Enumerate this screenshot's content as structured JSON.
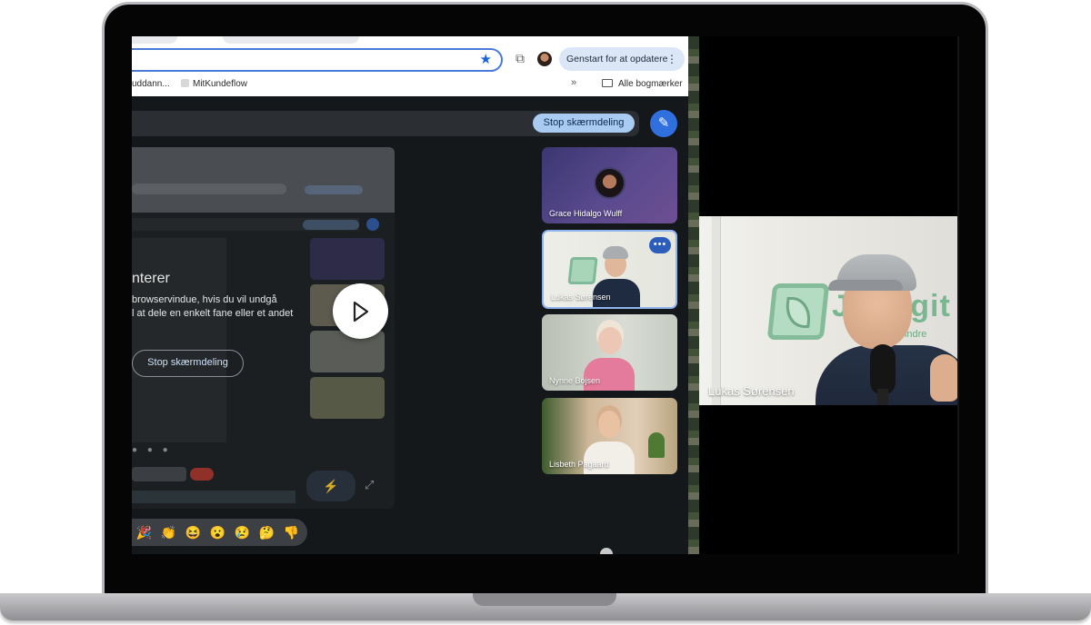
{
  "browser": {
    "update_button_label": "Genstart for at opdatere",
    "bookmarks": [
      "uddann...",
      "MitKundeflow"
    ],
    "all_bookmarks_label": "Alle bogmærker"
  },
  "meet": {
    "stop_share_label": "Stop skærmdeling",
    "presenting_title": "nterer",
    "presenting_text_line1": "browservindue, hvis du vil undgå",
    "presenting_text_line2": "l at dele en enkelt fane eller et andet",
    "stop_share_big_label": "Stop skærmdeling",
    "reactions": [
      "🎉",
      "👏",
      "😆",
      "😮",
      "😢",
      "🤔",
      "👎"
    ],
    "participants": [
      {
        "name": "Grace Hidalgo Wulff"
      },
      {
        "name": "Lukas Sørensen"
      },
      {
        "name": "Nynne Bojsen"
      },
      {
        "name": "Lisbeth Pagaard"
      }
    ],
    "more_options_label": "•••"
  },
  "camera": {
    "speaker_name": "Lukas Sørensen",
    "background_brand": "Jy Digit",
    "background_brand_sub": "r — Mindre"
  },
  "colors": {
    "accent_blue": "#2f6fde",
    "stop_share_bg": "#a9cbf2",
    "update_bg": "#dbe6f7"
  }
}
